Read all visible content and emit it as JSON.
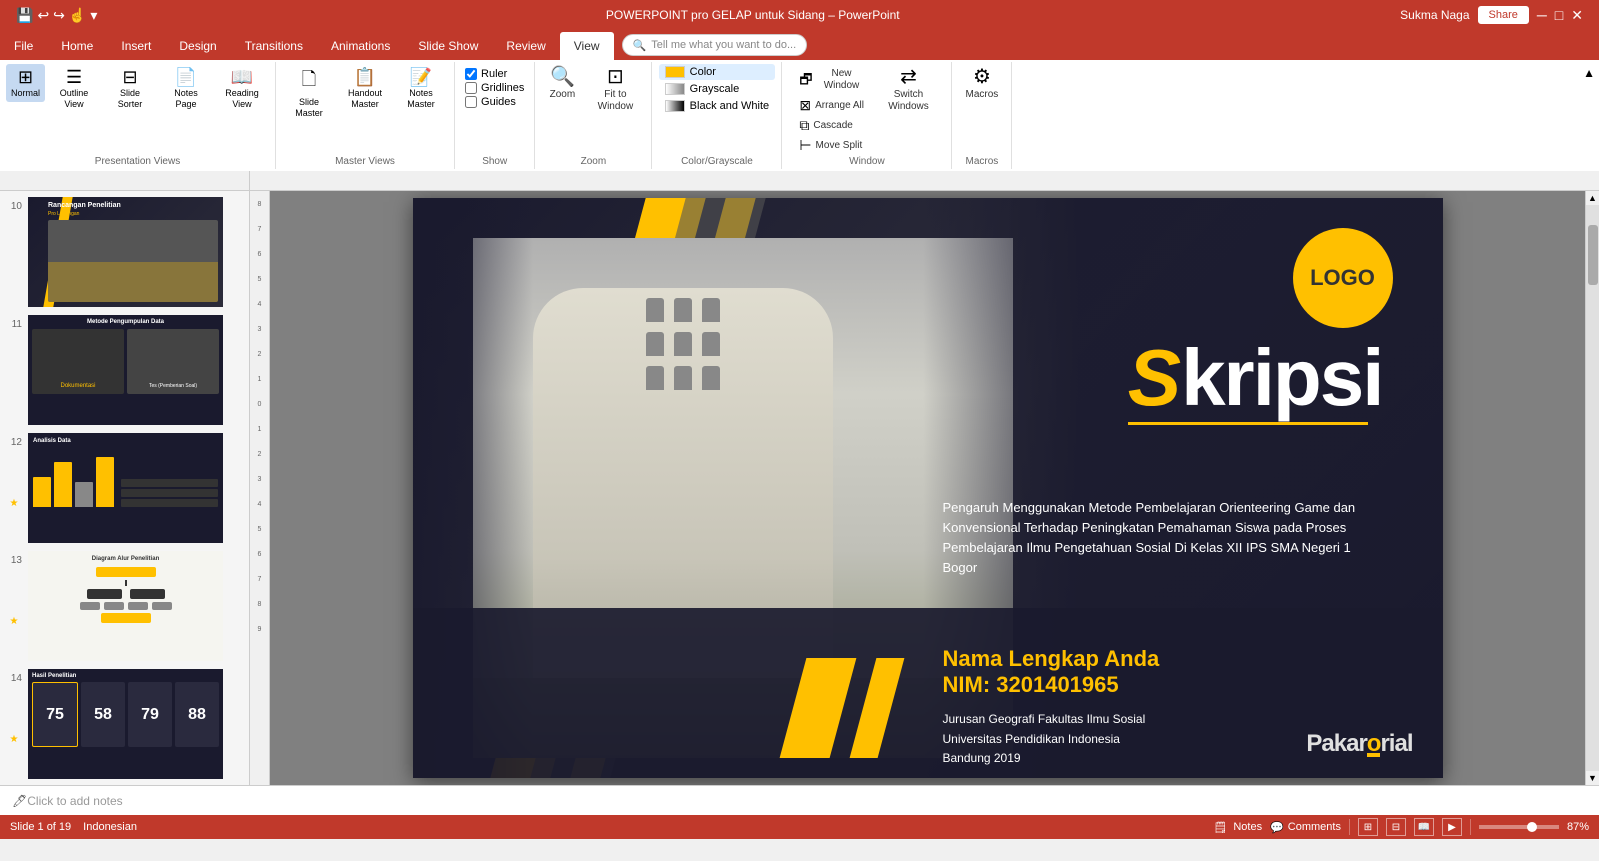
{
  "titlebar": {
    "title": "POWERPOINT pro GELAP untuk Sidang – PowerPoint",
    "controls": [
      "minimize",
      "maximize",
      "close"
    ]
  },
  "tabs": [
    {
      "id": "file",
      "label": "File"
    },
    {
      "id": "home",
      "label": "Home"
    },
    {
      "id": "insert",
      "label": "Insert"
    },
    {
      "id": "design",
      "label": "Design"
    },
    {
      "id": "transitions",
      "label": "Transitions"
    },
    {
      "id": "animations",
      "label": "Animations"
    },
    {
      "id": "slide_show",
      "label": "Slide Show"
    },
    {
      "id": "review",
      "label": "Review"
    },
    {
      "id": "view",
      "label": "View",
      "active": true
    }
  ],
  "ribbon": {
    "tell_me": "Tell me what you want to do...",
    "groups": [
      {
        "id": "presentation_views",
        "label": "Presentation Views",
        "buttons": [
          {
            "id": "normal",
            "icon": "⊞",
            "label": "Normal",
            "active": true
          },
          {
            "id": "outline_view",
            "icon": "☰",
            "label": "Outline View"
          },
          {
            "id": "slide_sorter",
            "icon": "⊟",
            "label": "Slide Sorter"
          },
          {
            "id": "notes_page",
            "icon": "📄",
            "label": "Notes Page"
          },
          {
            "id": "reading_view",
            "icon": "📖",
            "label": "Reading View"
          }
        ]
      },
      {
        "id": "master_views",
        "label": "Master Views",
        "buttons": [
          {
            "id": "slide_master",
            "icon": "🖹",
            "label": "Slide Master"
          },
          {
            "id": "handout_master",
            "icon": "📋",
            "label": "Handout Master"
          },
          {
            "id": "notes_master",
            "icon": "📝",
            "label": "Notes Master"
          }
        ]
      },
      {
        "id": "show",
        "label": "Show",
        "checkboxes": [
          {
            "id": "ruler",
            "label": "Ruler",
            "checked": true
          },
          {
            "id": "gridlines",
            "label": "Gridlines",
            "checked": false
          },
          {
            "id": "guides",
            "label": "Guides",
            "checked": false
          }
        ]
      },
      {
        "id": "zoom",
        "label": "Zoom",
        "buttons": [
          {
            "id": "zoom_btn",
            "icon": "🔍",
            "label": "Zoom"
          },
          {
            "id": "fit_to_window",
            "icon": "⊡",
            "label": "Fit to Window"
          }
        ]
      },
      {
        "id": "color_grayscale",
        "label": "Color/Grayscale",
        "options": [
          {
            "id": "color",
            "label": "Color",
            "selected": true,
            "swatch": "#ffc000"
          },
          {
            "id": "grayscale",
            "label": "Grayscale",
            "selected": false,
            "swatch": "#888"
          },
          {
            "id": "black_white",
            "label": "Black and White",
            "selected": false,
            "swatch": "#000"
          }
        ]
      },
      {
        "id": "window",
        "label": "Window",
        "buttons": [
          {
            "id": "new_window",
            "icon": "🗗",
            "label": "New Window"
          },
          {
            "id": "arrange_all",
            "icon": "⊟",
            "label": "Arrange All"
          },
          {
            "id": "cascade",
            "icon": "⊟",
            "label": "Cascade"
          },
          {
            "id": "move_split",
            "icon": "⊟",
            "label": "Move Split"
          },
          {
            "id": "switch_windows",
            "icon": "⇄",
            "label": "Switch Windows"
          }
        ]
      },
      {
        "id": "macros",
        "label": "Macros",
        "buttons": [
          {
            "id": "macros_btn",
            "icon": "⚙",
            "label": "Macros"
          }
        ]
      }
    ]
  },
  "notes_view": {
    "label": "Notes"
  },
  "slide_panel": {
    "slides": [
      {
        "num": "10",
        "type": "rancangan",
        "title": "Rancangan Penelitian",
        "subtitle": "Pro Lapangan"
      },
      {
        "num": "11",
        "type": "metode",
        "title": "Metode Pengumpulan Data",
        "subtitle": ""
      },
      {
        "num": "12",
        "type": "analisis",
        "title": "Analisis Data",
        "star": true
      },
      {
        "num": "13",
        "type": "diagram",
        "title": "Diagram Alur Penelitian",
        "star": true
      },
      {
        "num": "14",
        "type": "hasil",
        "title": "Hasil Penelitian",
        "star": true,
        "scores": [
          "75",
          "58",
          "79",
          "88"
        ]
      }
    ]
  },
  "slide": {
    "logo_text": "LOGO",
    "title_s": "S",
    "title_rest": "kripsi",
    "description": "Pengaruh Menggunakan Metode Pembelajaran Orienteering Game dan Konvensional Terhadap Peningkatan Pemahaman Siswa pada Proses Pembelajaran Ilmu Pengetahuan Sosial Di Kelas XII IPS SMA Negeri 1 Bogor",
    "name": "Nama Lengkap Anda",
    "nim": "NIM: 3201401965",
    "institution_line1": "Jurusan Geografi  Fakultas Ilmu Sosial",
    "institution_line2": "Universitas Pendidikan Indonesia",
    "institution_line3": "Bandung 2019",
    "brand": "PakarTutorial"
  },
  "statusbar": {
    "slide_info": "Slide 1 of 19",
    "language": "Indonesian",
    "notes_label": "Notes",
    "comments_label": "Comments",
    "zoom_percent": "87%"
  }
}
